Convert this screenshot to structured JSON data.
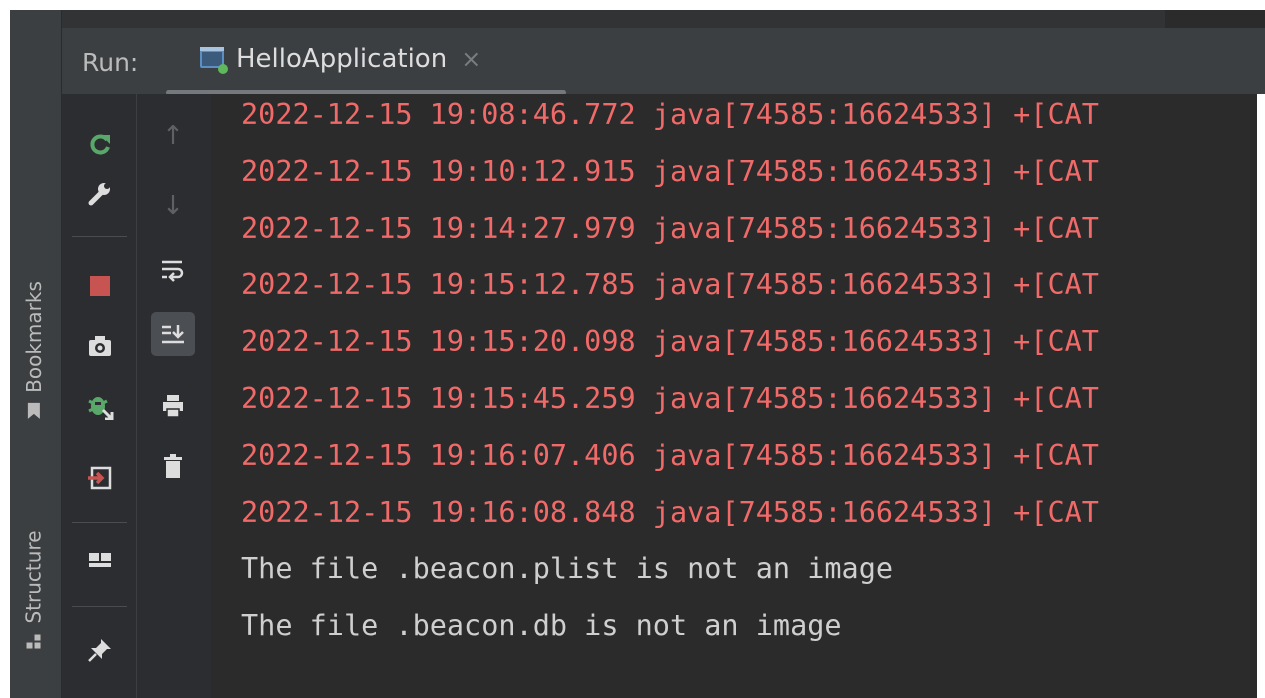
{
  "sidebar": {
    "bookmarks_label": "Bookmarks",
    "structure_label": "Structure"
  },
  "run_panel": {
    "label": "Run:",
    "tab_name": "HelloApplication",
    "tab_close": "×"
  },
  "toolbar": {
    "rerun": "rerun-icon",
    "settings": "wrench-icon",
    "stop": "stop-icon",
    "snapshot": "camera-icon",
    "debug": "debug-icon",
    "exit": "exit-icon",
    "layout": "layout-icon",
    "pin": "pin-icon",
    "up": "↑",
    "down": "↓",
    "soft_wrap": "soft-wrap-icon",
    "scroll_to_end": "scroll-to-end-icon",
    "print": "print-icon",
    "clear": "trash-icon"
  },
  "console": {
    "lines": [
      {
        "text": "2022-12-15 19:08:46.772 java[74585:16624533] +[CAT",
        "type": "err"
      },
      {
        "text": "2022-12-15 19:10:12.915 java[74585:16624533] +[CAT",
        "type": "err"
      },
      {
        "text": "2022-12-15 19:14:27.979 java[74585:16624533] +[CAT",
        "type": "err"
      },
      {
        "text": "2022-12-15 19:15:12.785 java[74585:16624533] +[CAT",
        "type": "err"
      },
      {
        "text": "2022-12-15 19:15:20.098 java[74585:16624533] +[CAT",
        "type": "err"
      },
      {
        "text": "2022-12-15 19:15:45.259 java[74585:16624533] +[CAT",
        "type": "err"
      },
      {
        "text": "2022-12-15 19:16:07.406 java[74585:16624533] +[CAT",
        "type": "err"
      },
      {
        "text": "2022-12-15 19:16:08.848 java[74585:16624533] +[CAT",
        "type": "err"
      },
      {
        "text": "The file .beacon.plist is not an image",
        "type": "out"
      },
      {
        "text": "The file .beacon.db is not an image",
        "type": "out"
      }
    ]
  },
  "colors": {
    "error_text": "#ef6a68",
    "output_text": "#cfcfcf",
    "stop_red": "#c75450",
    "rerun_green": "#59a869"
  }
}
